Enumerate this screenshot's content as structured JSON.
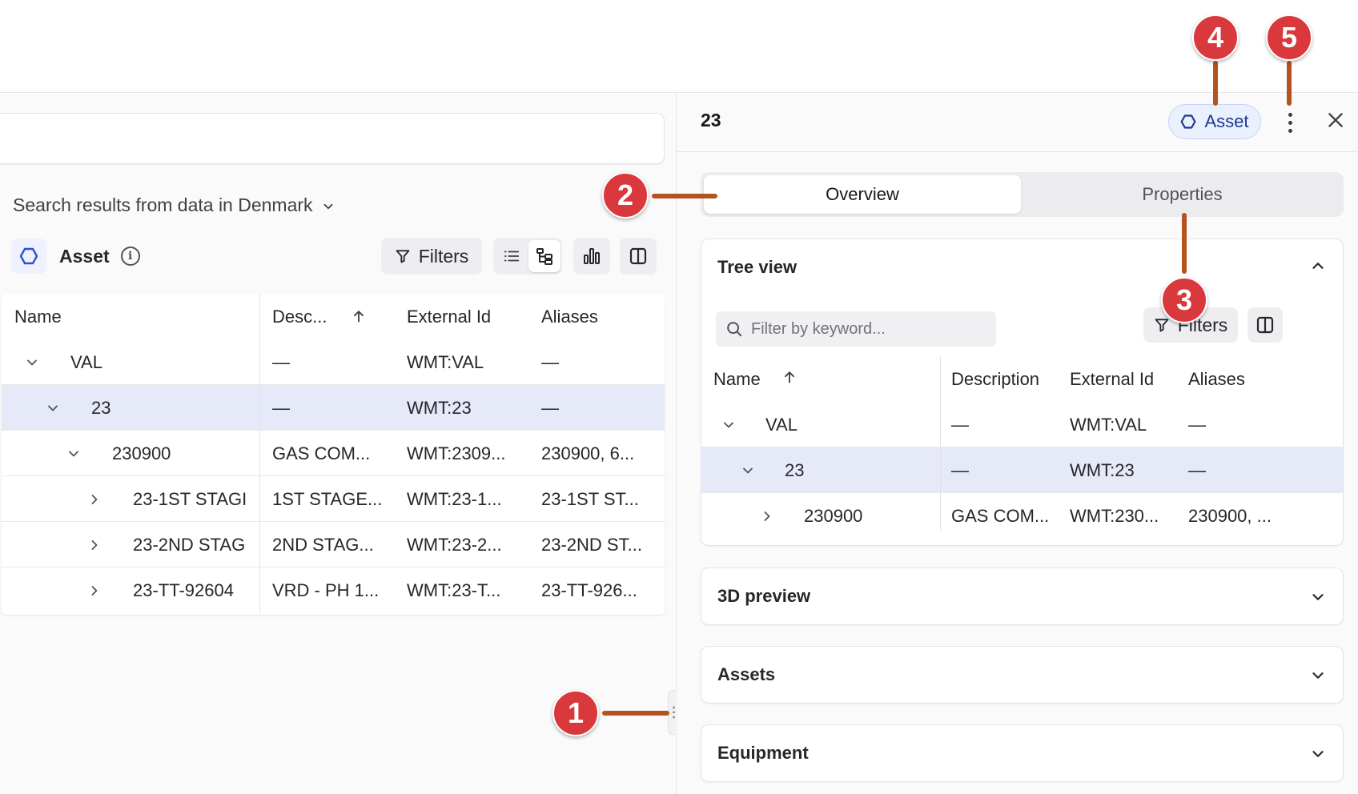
{
  "left": {
    "scope_text": "Search results from data in Denmark",
    "type_label": "Asset",
    "filters_label": "Filters",
    "columns": [
      "Name",
      "Desc...",
      "External Id",
      "Aliases"
    ],
    "rows": [
      {
        "name": "VAL",
        "desc": "—",
        "ext": "WMT:VAL",
        "alias": "—"
      },
      {
        "name": "23",
        "desc": "—",
        "ext": "WMT:23",
        "alias": "—"
      },
      {
        "name": "230900",
        "desc": "GAS COM...",
        "ext": "WMT:2309...",
        "alias": "230900, 6..."
      },
      {
        "name": "23-1ST STAGI",
        "desc": "1ST STAGE...",
        "ext": "WMT:23-1...",
        "alias": "23-1ST ST..."
      },
      {
        "name": "23-2ND STAG",
        "desc": "2ND STAG...",
        "ext": "WMT:23-2...",
        "alias": "23-2ND ST..."
      },
      {
        "name": "23-TT-92604",
        "desc": "VRD - PH 1...",
        "ext": "WMT:23-T...",
        "alias": "23-TT-926..."
      }
    ]
  },
  "right": {
    "title": "23",
    "type_chip": "Asset",
    "tabs": [
      "Overview",
      "Properties"
    ],
    "tree_view": {
      "title": "Tree view",
      "filter_placeholder": "Filter by keyword...",
      "filters_label": "Filters",
      "columns": [
        "Name",
        "Description",
        "External Id",
        "Aliases"
      ],
      "rows": [
        {
          "name": "VAL",
          "desc": "—",
          "ext": "WMT:VAL",
          "alias": "—"
        },
        {
          "name": "23",
          "desc": "—",
          "ext": "WMT:23",
          "alias": "—"
        },
        {
          "name": "230900",
          "desc": "GAS COM...",
          "ext": "WMT:230...",
          "alias": "230900, ..."
        }
      ]
    },
    "sections": [
      "3D preview",
      "Assets",
      "Equipment"
    ]
  },
  "callouts": [
    "1",
    "2",
    "3",
    "4",
    "5"
  ],
  "colors": {
    "accent": "#2f4fd1",
    "callout": "#d9393c",
    "selected_row": "#e5e9f8"
  }
}
